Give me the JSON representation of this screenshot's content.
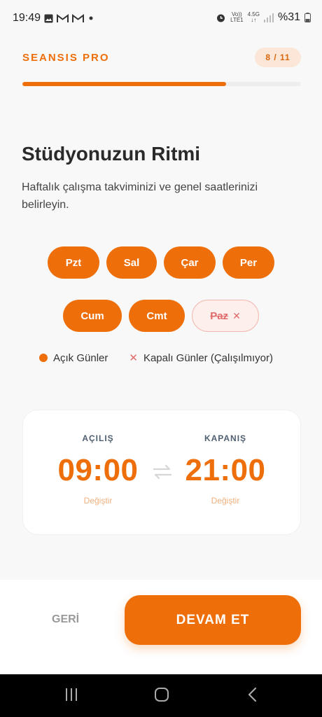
{
  "status_bar": {
    "time": "19:49",
    "left_icons": [
      "image-icon",
      "gmail-icon",
      "gmail-icon",
      "dot-icon"
    ],
    "volte_top": "Vo))",
    "volte_bottom": "LTE1",
    "net_top": "4.5G",
    "net_bottom": "↓↑",
    "battery": "%31"
  },
  "header": {
    "brand": "SEANSIS PRO",
    "step": "8 / 11",
    "progress": 0.73
  },
  "intro": {
    "title": "Stüdyonuzun Ritmi",
    "subtitle": "Haftalık çalışma takviminizi ve genel saatlerinizi belirleyin."
  },
  "days": [
    {
      "label": "Pzt",
      "open": true
    },
    {
      "label": "Sal",
      "open": true
    },
    {
      "label": "Çar",
      "open": true
    },
    {
      "label": "Per",
      "open": true
    },
    {
      "label": "Cum",
      "open": true
    },
    {
      "label": "Cmt",
      "open": true
    },
    {
      "label": "Paz",
      "open": false
    }
  ],
  "legend": {
    "open_label": "Açık Günler",
    "closed_mark": "✕",
    "closed_label": "Kapalı Günler (Çalışılmıyor)"
  },
  "hours": {
    "open_label": "AÇILIŞ",
    "open_time": "09:00",
    "close_label": "KAPANIŞ",
    "close_time": "21:00",
    "change_label": "Değiştir"
  },
  "footer": {
    "back_label": "GERİ",
    "continue_label": "DEVAM ET"
  },
  "colors": {
    "accent": "#ee6e0a",
    "closed": "#e06a6a"
  }
}
